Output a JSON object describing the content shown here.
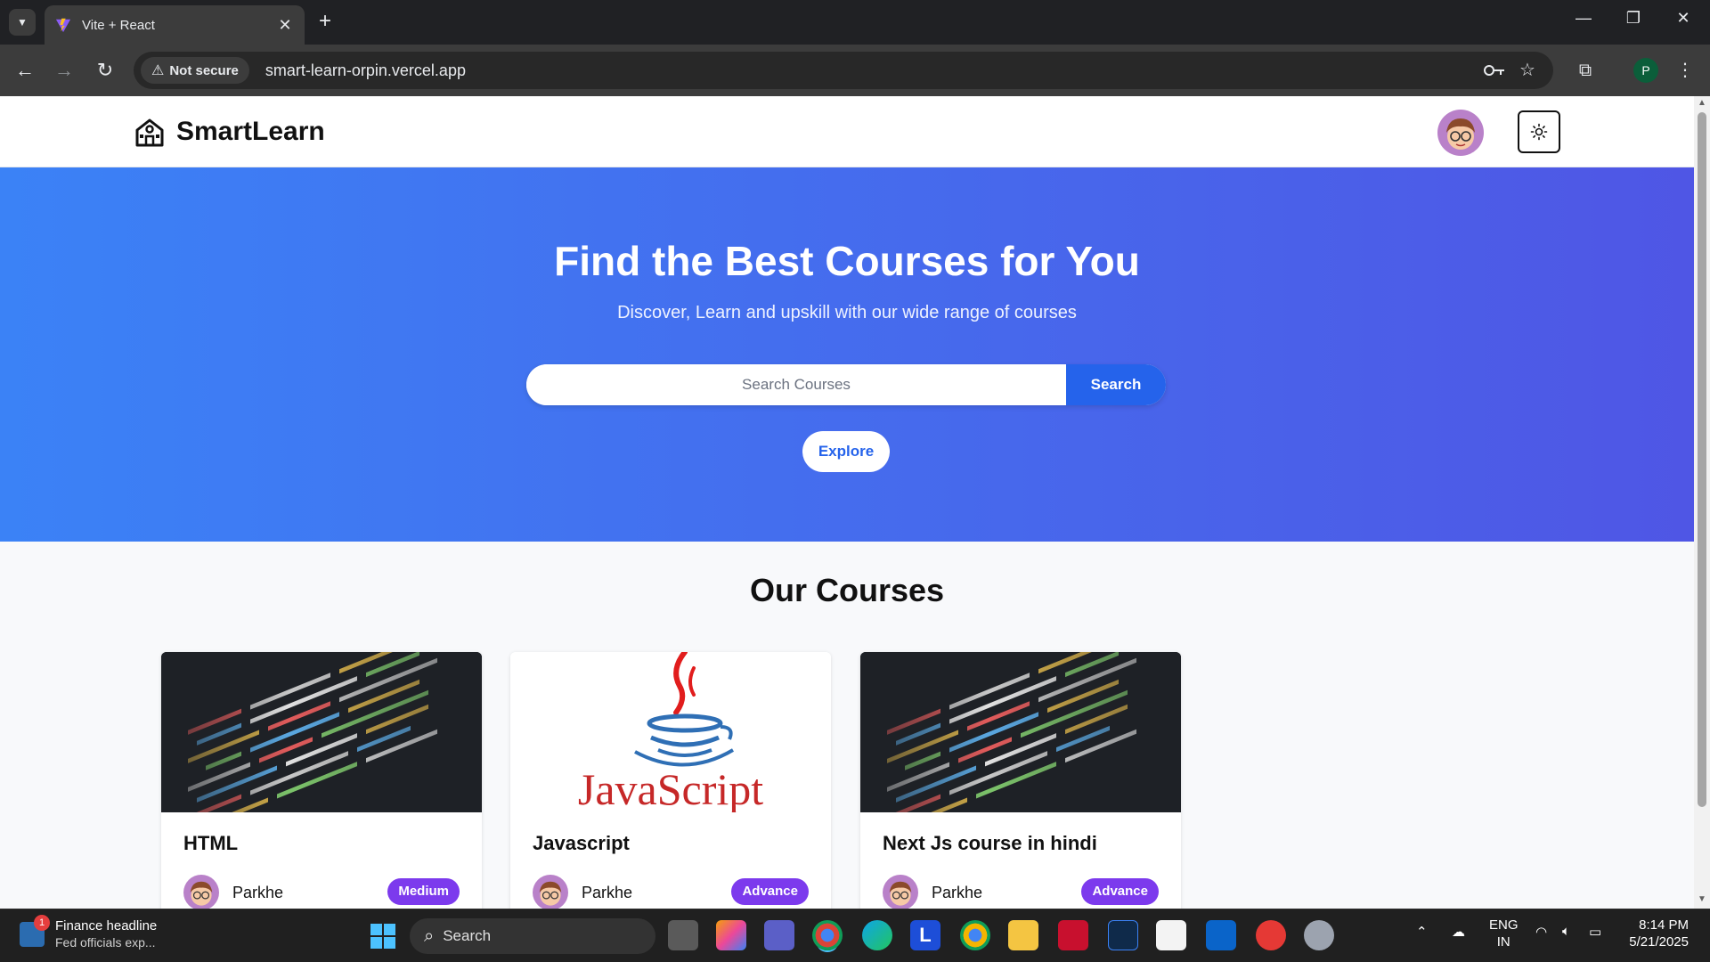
{
  "browser": {
    "tab_title": "Vite + React",
    "tab_close": "✕",
    "new_tab": "+",
    "security_label": "Not secure",
    "url": "smart-learn-orpin.vercel.app",
    "profile_initial": "P"
  },
  "header": {
    "brand": "SmartLearn"
  },
  "hero": {
    "title": "Find the Best Courses for You",
    "subtitle": "Discover, Learn and upskill with our wide range of courses",
    "search_placeholder": "Search Courses",
    "search_button": "Search",
    "explore_button": "Explore"
  },
  "courses": {
    "section_title": "Our Courses",
    "items": [
      {
        "title": "HTML",
        "author": "Parkhe",
        "level": "Medium",
        "image": "code-screen"
      },
      {
        "title": "Javascript",
        "author": "Parkhe",
        "level": "Advance",
        "image": "javascript-logo",
        "image_text": "JavaScript"
      },
      {
        "title": "Next Js course in hindi",
        "author": "Parkhe",
        "level": "Advance",
        "image": "code-screen"
      }
    ]
  },
  "taskbar": {
    "news_badge": "1",
    "news_headline": "Finance headline",
    "news_snippet": "Fed officials exp...",
    "search_label": "Search",
    "app_letter": "L",
    "lang": "ENG",
    "region": "IN",
    "time": "8:14 PM",
    "date": "5/21/2025"
  },
  "colors": {
    "hero_gradient_start": "#3b82f6",
    "hero_gradient_end": "#4f56e5",
    "search_button": "#2563eb",
    "badge": "#7c3aed"
  }
}
